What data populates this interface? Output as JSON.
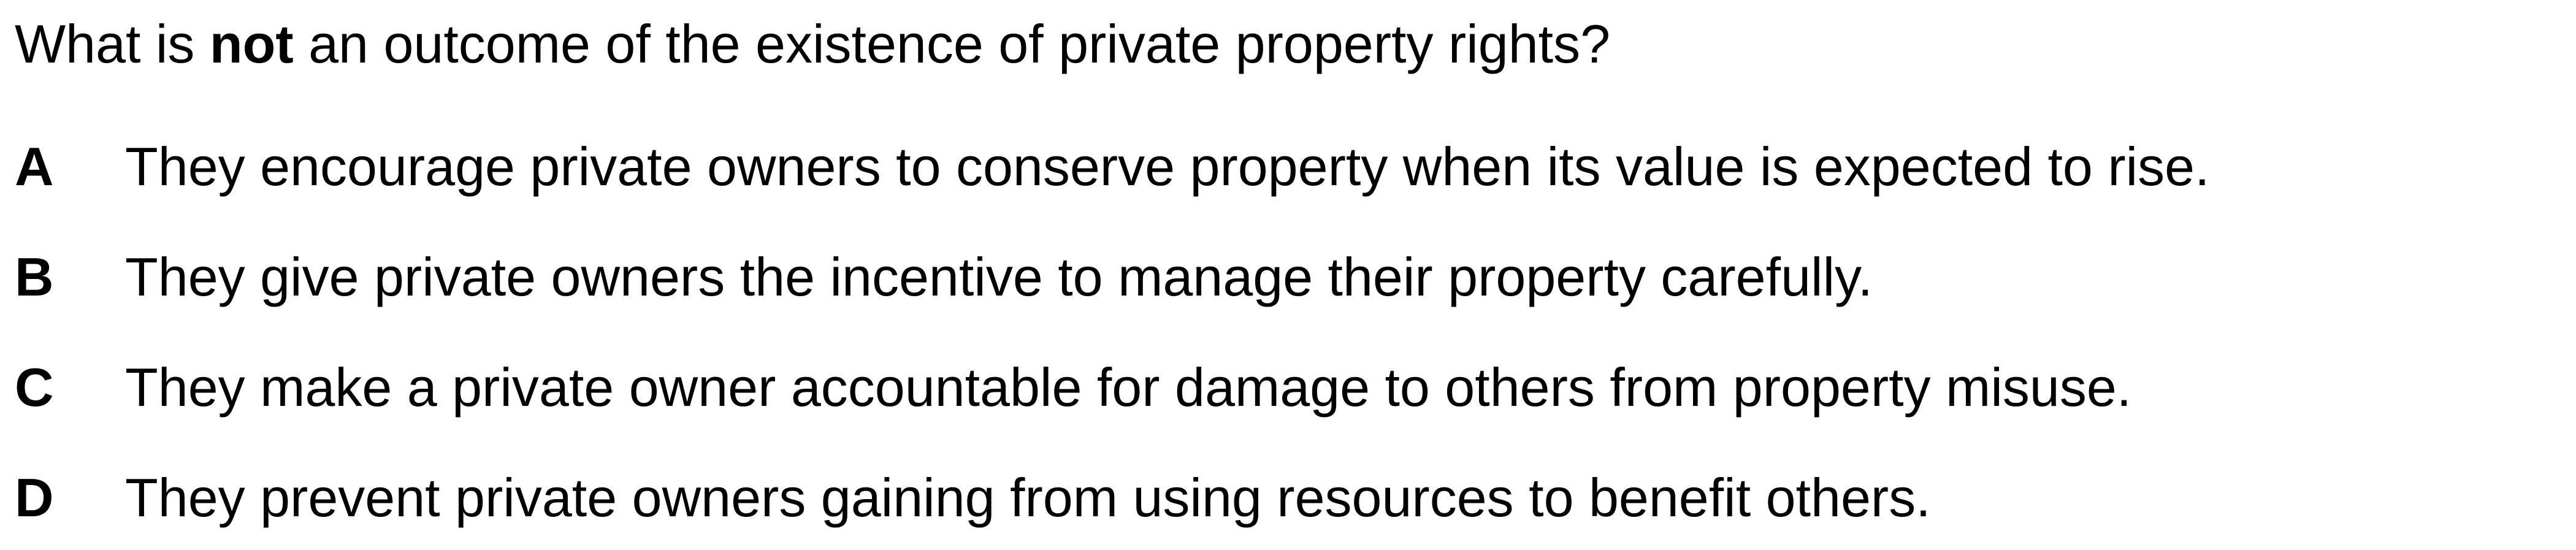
{
  "question": {
    "before": "What is ",
    "emphasis": "not",
    "after": " an outcome of the existence of private property rights?"
  },
  "options": [
    {
      "letter": "A",
      "text": "They encourage private owners to conserve property when its value is expected to rise."
    },
    {
      "letter": "B",
      "text": "They give private owners the incentive to manage their property carefully."
    },
    {
      "letter": "C",
      "text": "They make a private owner accountable for damage to others from property misuse."
    },
    {
      "letter": "D",
      "text": "They prevent private owners gaining from using resources to benefit others."
    }
  ]
}
